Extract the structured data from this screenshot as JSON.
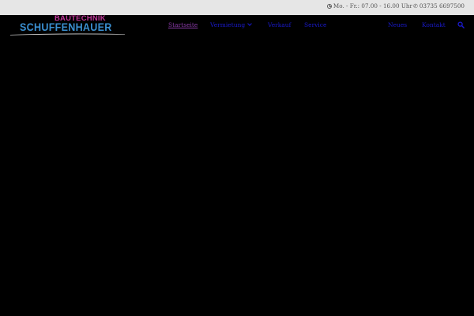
{
  "topbar": {
    "hours_icon": "clock-icon",
    "hours": "Mo. - Fr.: 07.00 - 16.00 Uhr",
    "phone_icon": "phone-icon",
    "phone": "03735 6697500"
  },
  "logo": {
    "line1": "BAUTECHNIK",
    "line2": "SCHUFFENHAUER",
    "colors": {
      "line1": "#c0399a",
      "line2": "#3a8fd0"
    }
  },
  "nav": {
    "items": [
      {
        "label": "Startseite",
        "active": true
      },
      {
        "label": "Vermietung",
        "has_dropdown": true
      },
      {
        "label": "Verkauf"
      },
      {
        "label": "Service"
      },
      {
        "label": "Neues"
      },
      {
        "label": "Kontakt"
      }
    ],
    "search_icon": "search-icon",
    "colors": {
      "link": "#1a1ad0",
      "active": "#8a3aa8"
    }
  }
}
